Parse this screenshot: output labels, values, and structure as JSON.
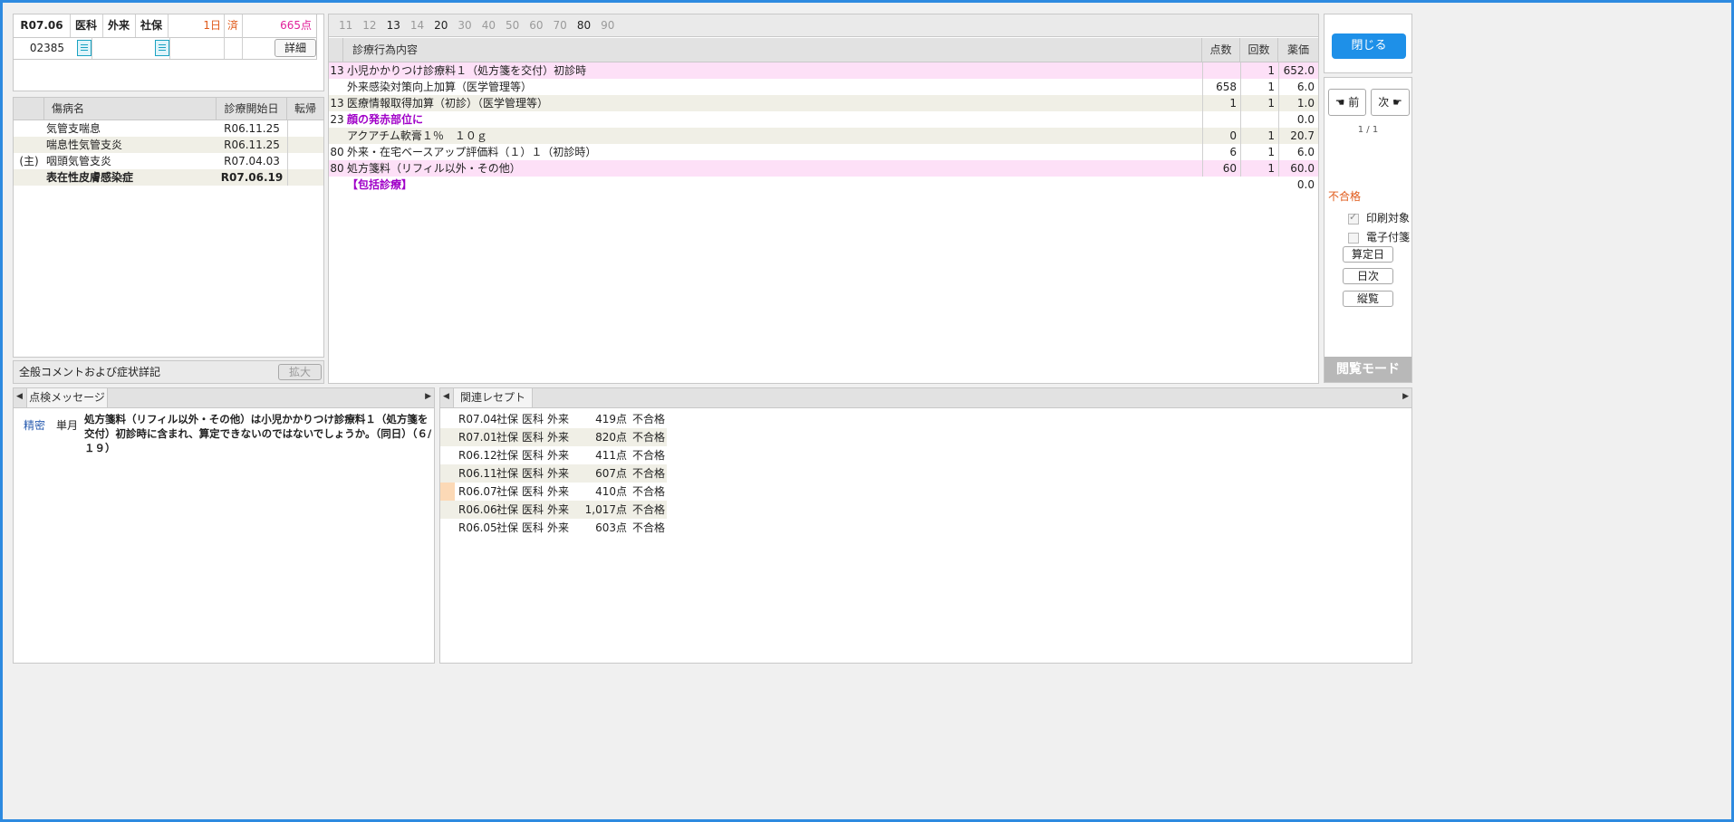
{
  "header": {
    "era_month": "R07.06",
    "type": "医科",
    "outpatient": "外来",
    "insurance": "社保",
    "days": "1日",
    "done": "済",
    "points": "665点",
    "patient_no": "02385",
    "detail_button": "詳細"
  },
  "day_ticks": [
    {
      "label": "11",
      "on": false
    },
    {
      "label": "12",
      "on": false
    },
    {
      "label": "13",
      "on": true
    },
    {
      "label": "14",
      "on": false
    },
    {
      "label": "20",
      "on": true
    },
    {
      "label": "30",
      "on": false
    },
    {
      "label": "40",
      "on": false
    },
    {
      "label": "50",
      "on": false
    },
    {
      "label": "60",
      "on": false
    },
    {
      "label": "70",
      "on": false
    },
    {
      "label": "80",
      "on": true
    },
    {
      "label": "90",
      "on": false
    }
  ],
  "disease_table": {
    "columns": [
      "傷病名",
      "診療開始日",
      "転帰"
    ],
    "rows": [
      {
        "mark": "",
        "name": "気管支喘息",
        "date": "R06.11.25",
        "outcome": "",
        "bold": false
      },
      {
        "mark": "",
        "name": "喘息性気管支炎",
        "date": "R06.11.25",
        "outcome": "",
        "bold": false
      },
      {
        "mark": "(主)",
        "name": "咽頭気管支炎",
        "date": "R07.04.03",
        "outcome": "",
        "bold": false
      },
      {
        "mark": "",
        "name": "表在性皮膚感染症",
        "date": "R07.06.19",
        "outcome": "",
        "bold": true
      }
    ]
  },
  "comment_section": {
    "label": "全般コメントおよび症状詳記",
    "expand_button": "拡大"
  },
  "treatment_table": {
    "columns": [
      "診療行為内容",
      "点数",
      "回数",
      "薬価"
    ],
    "rows": [
      {
        "code": "13",
        "content": "小児かかりつけ診療料１（処方箋を交付）初診時",
        "points": "",
        "count": "1",
        "price": "652.0",
        "style": "pink"
      },
      {
        "code": "",
        "content": "外来感染対策向上加算（医学管理等）",
        "points": "658",
        "count": "1",
        "price": "6.0",
        "style": "white"
      },
      {
        "code": "13",
        "content": "医療情報取得加算（初診）（医学管理等）",
        "points": "1",
        "count": "1",
        "price": "1.0",
        "style": "beige"
      },
      {
        "code": "23",
        "content": "顔の発赤部位に",
        "points": "",
        "count": "",
        "price": "0.0",
        "style": "purple"
      },
      {
        "code": "",
        "content": "アクアチム軟膏１％　１０ｇ",
        "points": "0",
        "count": "1",
        "price": "20.7",
        "style": "beige"
      },
      {
        "code": "80",
        "content": "外来・在宅ベースアップ評価料（１）１（初診時）",
        "points": "6",
        "count": "1",
        "price": "6.0",
        "style": "white"
      },
      {
        "code": "80",
        "content": "処方箋料（リフィル以外・その他）",
        "points": "60",
        "count": "1",
        "price": "60.0",
        "style": "pink"
      },
      {
        "code": "",
        "content": "【包括診療】",
        "points": "",
        "count": "",
        "price": "0.0",
        "style": "purple"
      }
    ]
  },
  "right_panel": {
    "close_button": "閉じる",
    "prev_button": "前",
    "next_button": "次",
    "page_indicator": "1 / 1",
    "status": "不合格",
    "print_target_label": "印刷対象",
    "print_target_checked": true,
    "e_tag_label": "電子付箋",
    "e_tag_checked": false,
    "calc_date_button": "算定日",
    "daily_button": "日次",
    "vertical_button": "縦覧",
    "mode_label": "閲覧モード"
  },
  "check_messages": {
    "tab_label": "点検メッセージ",
    "items": [
      {
        "level": "精密",
        "scope": "単月",
        "text": "処方箋料（リフィル以外・その他）は小児かかりつけ診療料１（処方箋を交付）初診時に含まれ、算定できないのではないでしょうか。（同日）（６/１９）"
      }
    ]
  },
  "related_receipts": {
    "tab_label": "関連レセプト",
    "rows": [
      {
        "month": "R07.04",
        "ins": "社保",
        "type": "医科",
        "io": "外来",
        "points": "419点",
        "result": "不合格"
      },
      {
        "month": "R07.01",
        "ins": "社保",
        "type": "医科",
        "io": "外来",
        "points": "820点",
        "result": "不合格"
      },
      {
        "month": "R06.12",
        "ins": "社保",
        "type": "医科",
        "io": "外来",
        "points": "411点",
        "result": "不合格"
      },
      {
        "month": "R06.11",
        "ins": "社保",
        "type": "医科",
        "io": "外来",
        "points": "607点",
        "result": "不合格"
      },
      {
        "month": "R06.07",
        "ins": "社保",
        "type": "医科",
        "io": "外来",
        "points": "410点",
        "result": "不合格"
      },
      {
        "month": "R06.06",
        "ins": "社保",
        "type": "医科",
        "io": "外来",
        "points": "1,017点",
        "result": "不合格"
      },
      {
        "month": "R06.05",
        "ins": "社保",
        "type": "医科",
        "io": "外来",
        "points": "603点",
        "result": "不合格"
      }
    ]
  },
  "colors": {
    "accent_blue": "#1e90e8",
    "pink_row": "#fde0f7",
    "beige_row": "#f0efe6",
    "purple_text": "#a000c8",
    "red_text": "#e05a1a",
    "points_magenta": "#e0209a"
  }
}
